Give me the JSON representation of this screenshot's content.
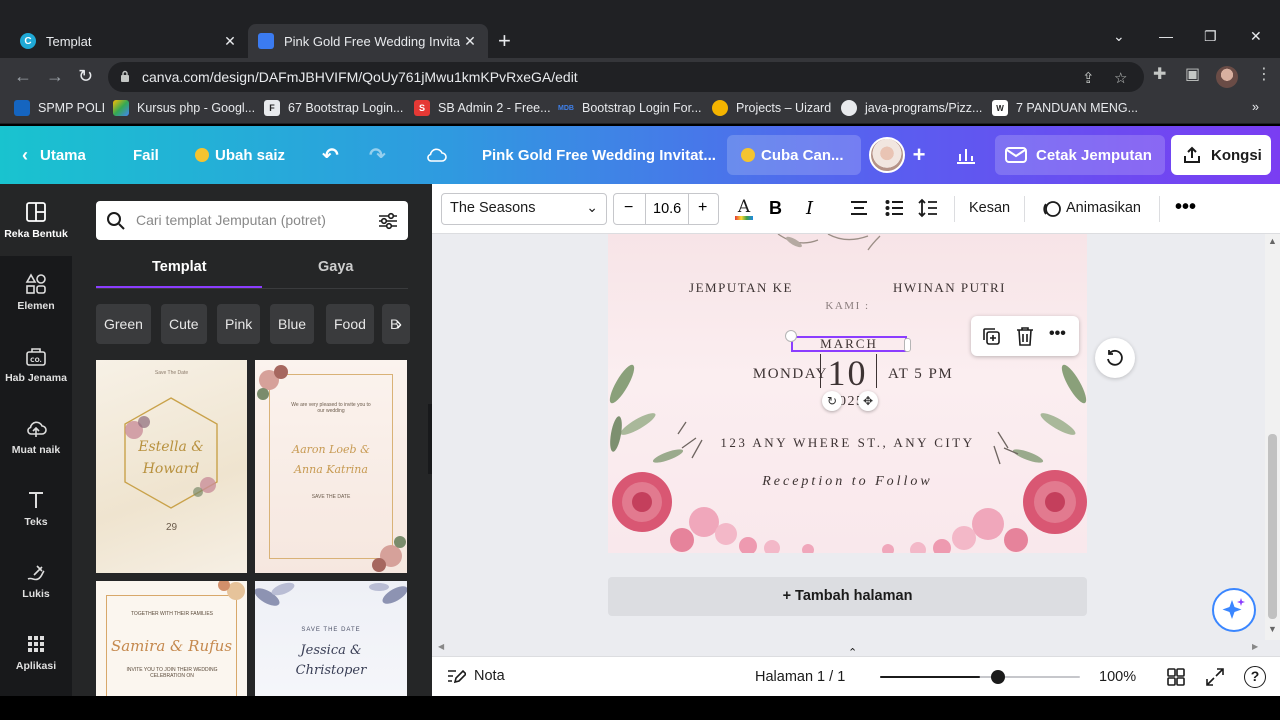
{
  "browser": {
    "tabs": [
      {
        "title": "Templat",
        "active": false
      },
      {
        "title": "Pink Gold Free Wedding Invitatio",
        "active": true
      }
    ],
    "url": "canva.com/design/DAFmJBHVIFM/QoUy761jMwu1kmKPvRxeGA/edit",
    "bookmarks": [
      "SPMP POLI",
      "Kursus php - Googl...",
      "67 Bootstrap Login...",
      "SB Admin 2 - Free...",
      "Bootstrap Login For...",
      "Projects – Uizard",
      "java-programs/Pizz...",
      "7 PANDUAN MENG..."
    ]
  },
  "header": {
    "home": "Utama",
    "file": "Fail",
    "resize": "Ubah saiz",
    "design_title": "Pink Gold Free Wedding Invitat...",
    "try_canva": "Cuba Can...",
    "print": "Cetak Jemputan",
    "share": "Kongsi"
  },
  "rail": [
    {
      "label": "Reka Bentuk",
      "icon": "layout-icon"
    },
    {
      "label": "Elemen",
      "icon": "shapes-icon"
    },
    {
      "label": "Hab Jenama",
      "icon": "brand-icon"
    },
    {
      "label": "Muat naik",
      "icon": "cloud-upload-icon"
    },
    {
      "label": "Teks",
      "icon": "text-icon"
    },
    {
      "label": "Lukis",
      "icon": "draw-icon"
    },
    {
      "label": "Aplikasi",
      "icon": "apps-icon"
    }
  ],
  "panel": {
    "search_placeholder": "Cari templat Jemputan (potret)",
    "filter_badge": "1",
    "tabs": [
      "Templat",
      "Gaya"
    ],
    "chips": [
      "Green",
      "Cute",
      "Pink",
      "Blue",
      "Food",
      "B"
    ],
    "thumbs": [
      {
        "top": "Save The Date",
        "names": "Estella & Howard",
        "date": "29"
      },
      {
        "top": "We are very pleased to invite you to our wedding",
        "names": "Aaron Loeb & Anna Katrina",
        "date": "SAVE THE DATE"
      },
      {
        "top": "TOGETHER WITH THEIR FAMILIES",
        "names": "Samira & Rufus",
        "date": "INVITE YOU TO JOIN THEIR WEDDING CELEBRATION ON"
      },
      {
        "top": "SAVE THE DATE",
        "names": "Jessica & Christoper",
        "date": ""
      }
    ]
  },
  "toolbar": {
    "font": "The Seasons",
    "size": "10.6",
    "effects": "Kesan",
    "animate": "Animasikan"
  },
  "invitation": {
    "line1a": "JEMPUTAN KE",
    "line1b": "HWINAN PUTRI",
    "line2": "KAMI :",
    "month": "MARCH",
    "day_name": "MONDAY",
    "day": "10",
    "time": "AT 5 PM",
    "year": "2025",
    "address": "123 ANY WHERE ST., ANY CITY",
    "reception": "Reception to Follow"
  },
  "add_page": "+ Tambah halaman",
  "footer": {
    "notes": "Nota",
    "page": "Halaman 1 / 1",
    "zoom": "100%",
    "zoom_level": 0.5
  },
  "colors": {
    "accent": "#8b3dff",
    "header_start": "#19c3cf",
    "header_end": "#7a3df2",
    "selection": "#8b3dff"
  }
}
